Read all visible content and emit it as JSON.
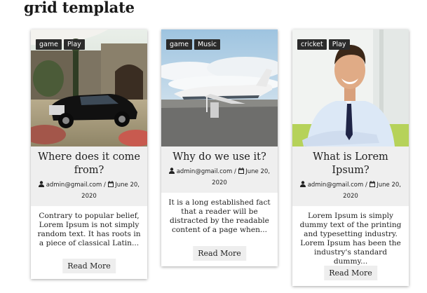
{
  "page": {
    "title": "grid template"
  },
  "posts": [
    {
      "tags": [
        "game",
        "Play"
      ],
      "title": "Where does it come from?",
      "author": "admin@gmail.com /",
      "date": "June 20, 2020",
      "excerpt": "Contrary to popular belief, Lorem Ipsum is not simply random text. It has roots in a piece of classical Latin...",
      "button": "Read More",
      "image": "luxury-car-photo"
    },
    {
      "tags": [
        "game",
        "Music"
      ],
      "title": "Why do we use it?",
      "author": "admin@gmail.com /",
      "date": "June 20, 2020",
      "excerpt": "It is a long established fact that a reader will be distracted by the readable content of a page when...",
      "button": "Read More",
      "image": "private-jet-photo"
    },
    {
      "tags": [
        "cricket",
        "Play"
      ],
      "title": "What is Lorem Ipsum?",
      "author": "admin@gmail.com /",
      "date": "June 20, 2020",
      "excerpt": "Lorem Ipsum is simply dummy text of the printing and typesetting industry. Lorem Ipsum has been the industry's standard dummy...",
      "button": "Read More",
      "image": "businessman-photo"
    }
  ]
}
